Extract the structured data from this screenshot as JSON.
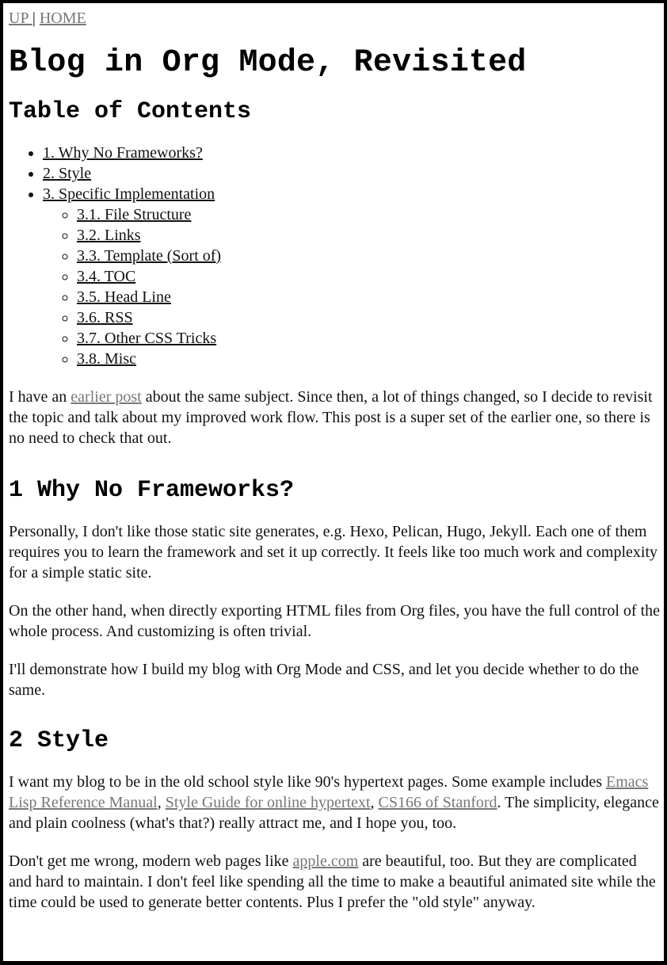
{
  "nav": {
    "up": "UP ",
    "sep": " | ",
    "home": "HOME"
  },
  "title": "Blog in Org Mode, Revisited",
  "toc": {
    "heading": "Table of Contents",
    "items": [
      {
        "label": "1. Why No Frameworks?"
      },
      {
        "label": "2. Style"
      },
      {
        "label": "3. Specific Implementation",
        "children": [
          "3.1. File Structure",
          "3.2. Links",
          "3.3. Template (Sort of)",
          "3.4. TOC",
          "3.5. Head Line",
          "3.6. RSS",
          "3.7. Other CSS Tricks",
          "3.8. Misc"
        ]
      }
    ]
  },
  "intro": {
    "before": "I have an ",
    "link": "earlier post",
    "after": " about the same subject. Since then, a lot of things changed, so I decide to revisit the topic and talk about my improved work flow. This post is a super set of the earlier one, so there is no need to check that out."
  },
  "section1": {
    "heading": "1 Why No Frameworks?",
    "p1": "Personally, I don't like those static site generates, e.g. Hexo, Pelican, Hugo, Jekyll. Each one of them requires you to learn the framework and set it up correctly. It feels like too much work and complexity for a simple static site.",
    "p2": "On the other hand, when directly exporting HTML files from Org files, you have the full control of the whole process. And customizing is often trivial.",
    "p3": "I'll demonstrate how I build my blog with Org Mode and CSS, and let you decide whether to do the same."
  },
  "section2": {
    "heading": "2 Style",
    "p1_before": "I want my blog to be in the old school style like 90's hypertext pages. Some example includes ",
    "link1": "Emacs Lisp Reference Manual",
    "comma1": ", ",
    "link2": "Style Guide for online hypertext",
    "comma2": ", ",
    "link3": "CS166 of Stanford",
    "p1_after": ". The simplicity, elegance and plain coolness (what's that?) really attract me, and I hope you, too.",
    "p2_before": "Don't get me wrong, modern web pages like ",
    "link4": "apple.com",
    "p2_after": " are beautiful, too. But they are complicated and hard to maintain. I don't feel like spending all the time to make a beautiful animated site while the time could be used to generate better contents. Plus I prefer the \"old style\" anyway."
  },
  "colors": {
    "link_visited": "#777777",
    "text": "#111111",
    "border": "#000000"
  }
}
